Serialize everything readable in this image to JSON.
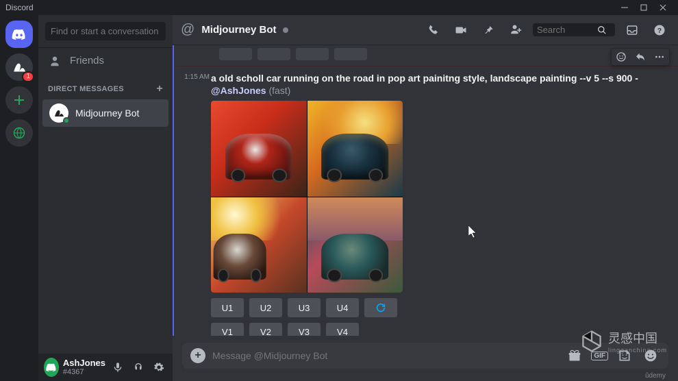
{
  "app_name": "Discord",
  "titlebar": {
    "label": "Discord"
  },
  "servers": {
    "dm_badge": "1"
  },
  "sidebar": {
    "search_placeholder": "Find or start a conversation",
    "friends_label": "Friends",
    "dm_header": "DIRECT MESSAGES",
    "dm_item": {
      "name": "Midjourney Bot"
    },
    "user": {
      "name": "AshJones",
      "tag": "#4367"
    }
  },
  "header": {
    "title": "Midjourney Bot",
    "search_placeholder": "Search"
  },
  "message": {
    "timestamp": "1:15 AM",
    "prompt": "a old scholl car running on the road in pop art painitng style, landscape painting --v 5 --s 900",
    "separator": " - ",
    "mention": "@AshJones",
    "suffix": " (fast)",
    "u_buttons": [
      "U1",
      "U2",
      "U3",
      "U4"
    ],
    "v_buttons": [
      "V1",
      "V2",
      "V3",
      "V4"
    ]
  },
  "composer": {
    "placeholder": "Message @Midjourney Bot",
    "gif_label": "GIF"
  },
  "watermark": {
    "main": "灵感中国",
    "sub": "lingganchina.com",
    "footer": "ûdemy"
  }
}
